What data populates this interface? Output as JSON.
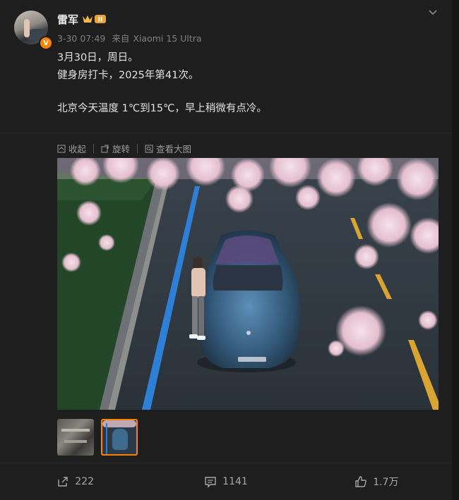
{
  "post": {
    "author": {
      "name": "雷军",
      "verified_badge": "V",
      "avatar_icon": "avatar-photo",
      "crown_icon": "crown-level-badge",
      "crown_level": "II"
    },
    "timestamp": "3-30 07:49",
    "source_prefix": "来自",
    "source_device": "Xiaomi 15 Ultra",
    "content_lines": [
      "3月30日，周日。",
      "健身房打卡，2025年第41次。",
      "",
      "北京今天温度 1℃到15℃，早上稍微有点冷。"
    ],
    "image_toolbar": {
      "collapse_label": "收起",
      "rotate_label": "旋转",
      "view_large_label": "查看大图"
    },
    "thumbnails": [
      {
        "name": "gym-photo-thumbnail",
        "selected": false
      },
      {
        "name": "car-photo-thumbnail",
        "selected": true
      }
    ],
    "actions": {
      "repost_count": "222",
      "comment_count": "1141",
      "like_count": "1.7万"
    }
  },
  "colors": {
    "accent": "#ff8200",
    "background": "#1e1e1e",
    "text": "#e2e2e2",
    "muted": "#808080"
  }
}
